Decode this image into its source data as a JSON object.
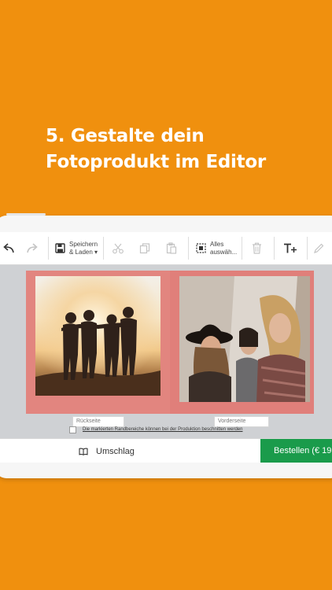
{
  "headline": {
    "line1": "5. Gestalte dein",
    "line2": "Fotoprodukt im Editor"
  },
  "toolbar": {
    "save_load_line1": "Speichern",
    "save_load_line2": "& Laden ▾",
    "select_all_line1": "Alles",
    "select_all_line2": "auswäh..."
  },
  "canvas": {
    "left_page_label": "Rückseite",
    "right_page_label": "Vorderseite",
    "notice": "Die markierten Randbereiche können bei der Produktion beschnitten werden"
  },
  "bottom": {
    "cover_label": "Umschlag",
    "order_label": "Bestellen (€ 19"
  },
  "colors": {
    "background": "#F0900E",
    "order_button": "#1a9b4b",
    "bleed_area": "#e2857f"
  }
}
